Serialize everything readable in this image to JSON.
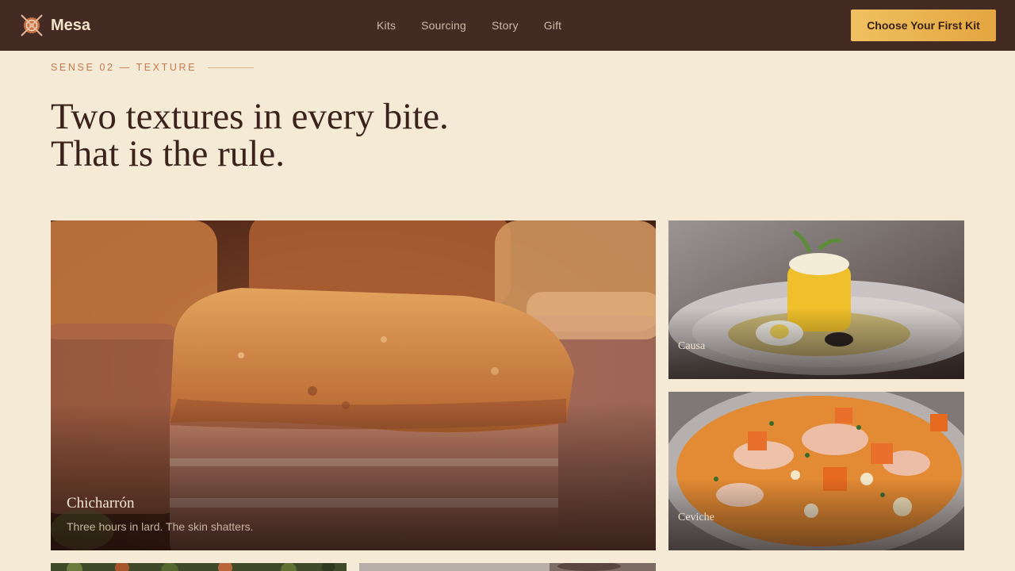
{
  "brand": {
    "name": "Mesa",
    "logo_icon": "crossed-utensils-icon"
  },
  "nav": {
    "items": [
      "Kits",
      "Sourcing",
      "Story",
      "Gift"
    ]
  },
  "cta": {
    "label": "Choose Your First Kit"
  },
  "section": {
    "eyebrow": "SENSE 02 — TEXTURE",
    "headline_line1": "Two textures in every bite.",
    "headline_line2": "That is the rule."
  },
  "cards": {
    "main": {
      "title": "Chicharrón",
      "subtitle": "Three hours in lard. The skin shatters."
    },
    "causa": {
      "title": "Causa"
    },
    "ceviche": {
      "title": "Ceviche"
    }
  },
  "colors": {
    "header_bg": "#432a23",
    "page_bg": "#f4ead6",
    "accent": "#e3a640",
    "eyebrow": "#c47a4e"
  }
}
